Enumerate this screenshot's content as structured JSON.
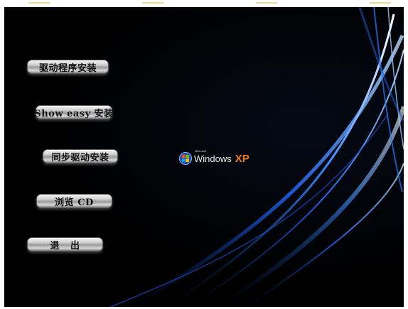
{
  "menu": {
    "items": [
      {
        "id": "driver-install",
        "label": "驱动程序安装"
      },
      {
        "id": "showeasy-install",
        "label": "Show easy 安装"
      },
      {
        "id": "sync-driver-install",
        "label": "同步驱动安装"
      },
      {
        "id": "browse-cd",
        "label": "浏览 CD"
      },
      {
        "id": "exit",
        "label": "退   出"
      }
    ]
  },
  "logo": {
    "small_text": "Microsoft",
    "word": "Windows",
    "xp": "XP"
  },
  "colors": {
    "background": "#000000",
    "accent_blue": "#2f7fff",
    "xp_orange": "#f07a15"
  }
}
